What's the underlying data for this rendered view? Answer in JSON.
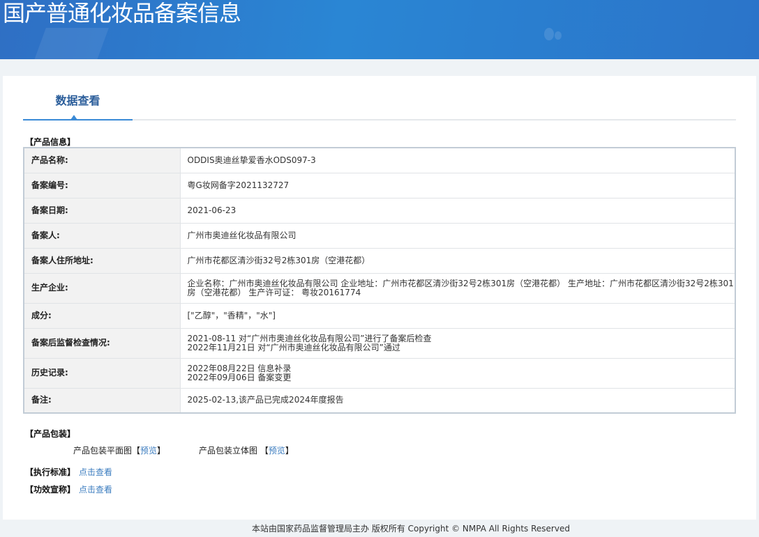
{
  "header": {
    "title": "国产普通化妆品备案信息"
  },
  "tabs": [
    {
      "label": "数据查看"
    }
  ],
  "sections": {
    "product_info": "【产品信息】",
    "packaging": "【产品包装】",
    "standard": "【执行标准】",
    "efficacy": "【功效宣称】"
  },
  "rows": [
    {
      "label": "产品名称:",
      "value": "ODDIS奥迪丝挚爱香水ODS097-3"
    },
    {
      "label": "备案编号:",
      "value": "粤G妆网备字2021132727"
    },
    {
      "label": "备案日期:",
      "value": "2021-06-23"
    },
    {
      "label": "备案人:",
      "value": "广州市奥迪丝化妆品有限公司"
    },
    {
      "label": "备案人住所地址:",
      "value": "广州市花都区清沙街32号2栋301房（空港花都）"
    },
    {
      "label": "生产企业:",
      "value": "企业名称：广州市奥迪丝化妆品有限公司 企业地址：广州市花都区清沙街32号2栋301房（空港花都） 生产地址：广州市花都区清沙街32号2栋301房（空港花都） 生产许可证： 粤妆20161774"
    },
    {
      "label": "成分:",
      "value": "[\"乙醇\"，\"香精\"，\"水\"]"
    },
    {
      "label": "备案后监督检查情况:",
      "lines": [
        "2021-08-11 对“广州市奥迪丝化妆品有限公司”进行了备案后检查",
        "2022年11月21日 对“广州市奥迪丝化妆品有限公司”通过"
      ]
    },
    {
      "label": "历史记录:",
      "lines": [
        "2022年08月22日 信息补录",
        "2022年09月06日 备案变更"
      ]
    },
    {
      "label": "备注:",
      "value": "2025-02-13,该产品已完成2024年度报告"
    }
  ],
  "packaging": {
    "flat_label": "产品包装平面图",
    "flat_link": "预览",
    "solid_label": "产品包装立体图",
    "solid_link": "预览",
    "open": "【",
    "close": "】"
  },
  "links": {
    "standard": "点击查看",
    "efficacy": "点击查看"
  },
  "footer": "本站由国家药品监督管理局主办 版权所有 Copyright © NMPA All Rights Reserved"
}
